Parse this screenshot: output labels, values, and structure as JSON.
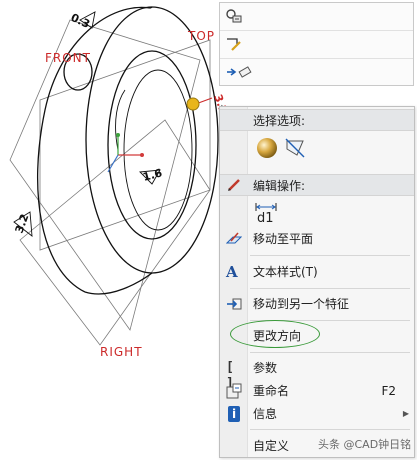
{
  "viewport": {
    "datum_planes": {
      "front": "FRONT",
      "top": "TOP",
      "right": "RIGHT"
    },
    "dimensions": [
      "0.3",
      "1.6",
      "3.2",
      "3.2"
    ]
  },
  "context_menu": {
    "section_select": "选择选项:",
    "section_edit": "编辑操作:",
    "items": {
      "move_to_plane": "移动至平面",
      "text_style": "文本样式(T)",
      "move_to_feature": "移动到另一个特征",
      "change_direction": "更改方向",
      "parameters": "参数",
      "rename": "重命名",
      "rename_shortcut": "F2",
      "info": "信息",
      "info_arrow": "▶",
      "customize": "自定义"
    }
  },
  "watermark": "头条 @CAD钟日铭",
  "icons": {
    "dim_icon_text": "d1",
    "text_style_icon": "A",
    "info_icon": "i",
    "params_icon": "[ ]"
  },
  "colors": {
    "datum_label": "#cc2a2a",
    "highlight": "#3a9a3a",
    "annotation_marker": "#e8b51c"
  }
}
